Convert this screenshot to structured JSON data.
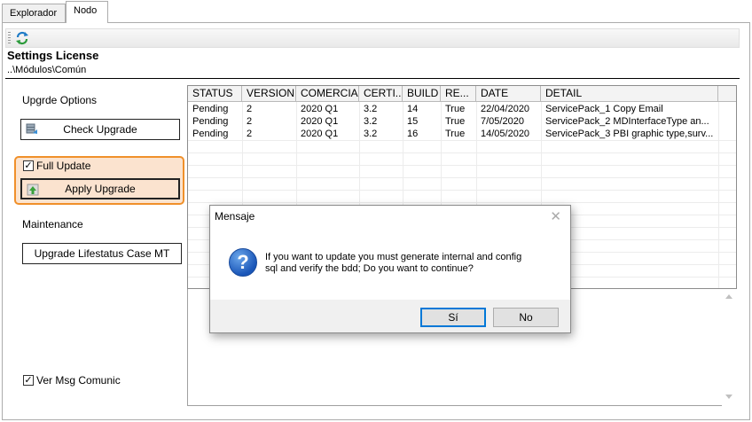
{
  "tabs": [
    {
      "label": "Explorador"
    },
    {
      "label": "Nodo"
    }
  ],
  "toolbar": {
    "refresh_icon": "refresh-icon"
  },
  "header": {
    "title": "Settings License",
    "path": "..\\Módulos\\Común"
  },
  "left": {
    "upgrade_options_label": "Upgrde Options",
    "check_upgrade_label": "Check Upgrade",
    "full_update_label": "Full Update",
    "full_update_checked": true,
    "apply_upgrade_label": "Apply Upgrade",
    "maintenance_label": "Maintenance",
    "lifestatus_label": "Upgrade Lifestatus Case MT",
    "ver_msg_label": "Ver Msg Comunic",
    "ver_msg_checked": true,
    "highlight_color": "#f0902a"
  },
  "grid": {
    "columns": [
      "STATUS",
      "VERSION",
      "COMERCIAL",
      "CERTI...",
      "BUILD",
      "RE...",
      "DATE",
      "DETAIL"
    ],
    "rows": [
      [
        "Pending",
        "2",
        "2020 Q1",
        "3.2",
        "14",
        "True",
        "22/04/2020",
        "ServicePack_1 Copy Email"
      ],
      [
        "Pending",
        "2",
        "2020 Q1",
        "3.2",
        "15",
        "True",
        "7/05/2020",
        "ServicePack_2 MDInterfaceType an..."
      ],
      [
        "Pending",
        "2",
        "2020 Q1",
        "3.2",
        "16",
        "True",
        "14/05/2020",
        "ServicePack_3 PBI graphic type,surv..."
      ]
    ]
  },
  "dialog": {
    "title": "Mensaje",
    "icon": "question-icon",
    "message": "If you want to update you must generate internal and config\nsql and verify the bdd;  Do you want to continue?",
    "yes_label": "Sí",
    "no_label": "No"
  }
}
